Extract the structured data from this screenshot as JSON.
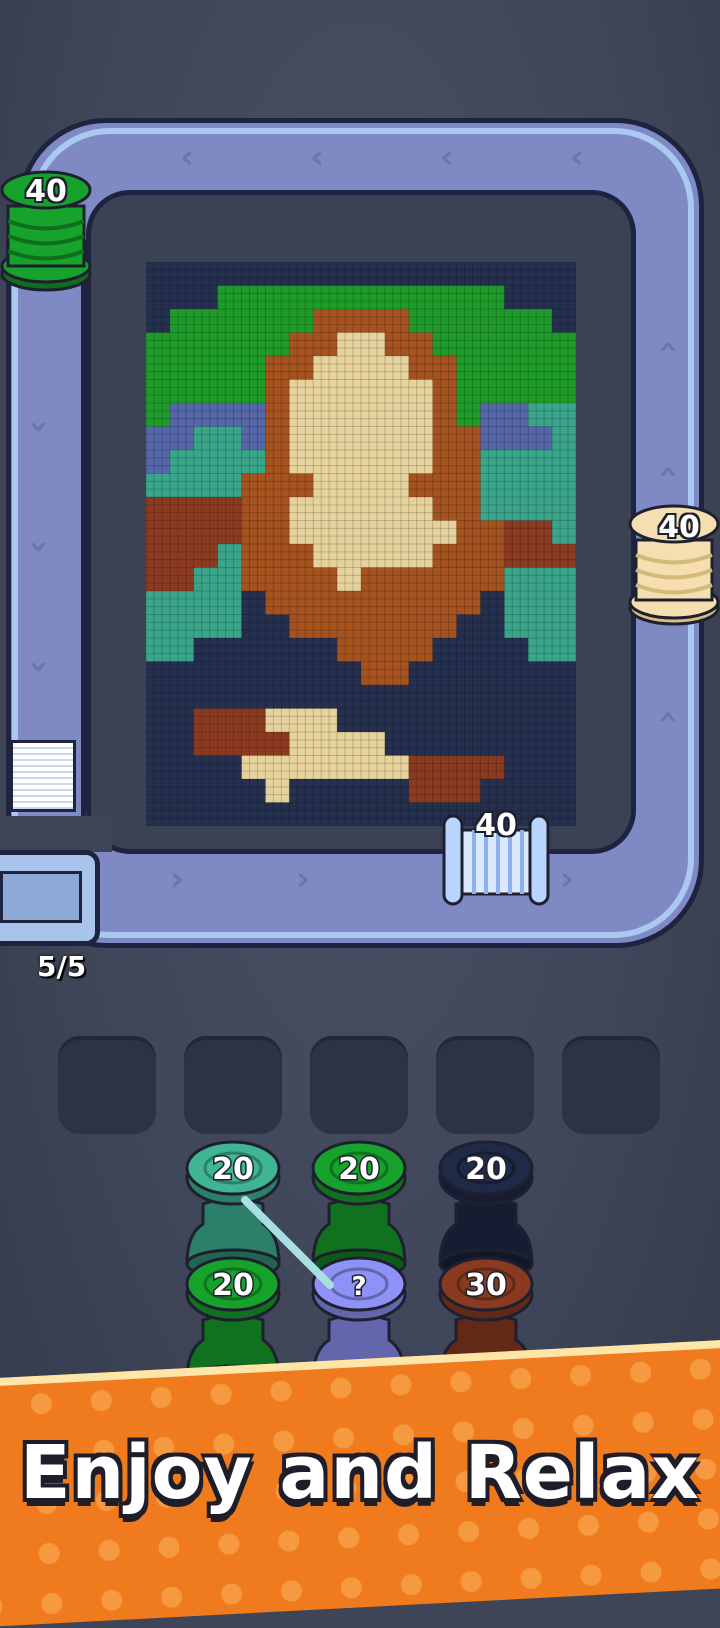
{
  "board": {
    "progress_counter": "5/5",
    "conveyor_spools": [
      {
        "label": "40",
        "color": "#17a22b",
        "position": "top-left"
      },
      {
        "label": "40",
        "color": "#f5dfb0",
        "position": "right"
      },
      {
        "label": "40",
        "color": "#b8d4ff",
        "position": "bottom"
      }
    ]
  },
  "slots": {
    "count": 5
  },
  "spool_grid": [
    {
      "label": "20",
      "color": "#3fb594"
    },
    {
      "label": "20",
      "color": "#17a22b"
    },
    {
      "label": "20",
      "color": "#1f2a48"
    },
    {
      "label": "20",
      "color": "#17a22b"
    },
    {
      "label": "?",
      "color": "#8e92f6"
    },
    {
      "label": "30",
      "color": "#8a3a20"
    }
  ],
  "banner": {
    "text": "Enjoy and Relax"
  },
  "colors": {
    "track": "#7f89c4",
    "track_rim": "#a9c9f1",
    "background": "#3e4556",
    "banner": "#f07a1e"
  }
}
